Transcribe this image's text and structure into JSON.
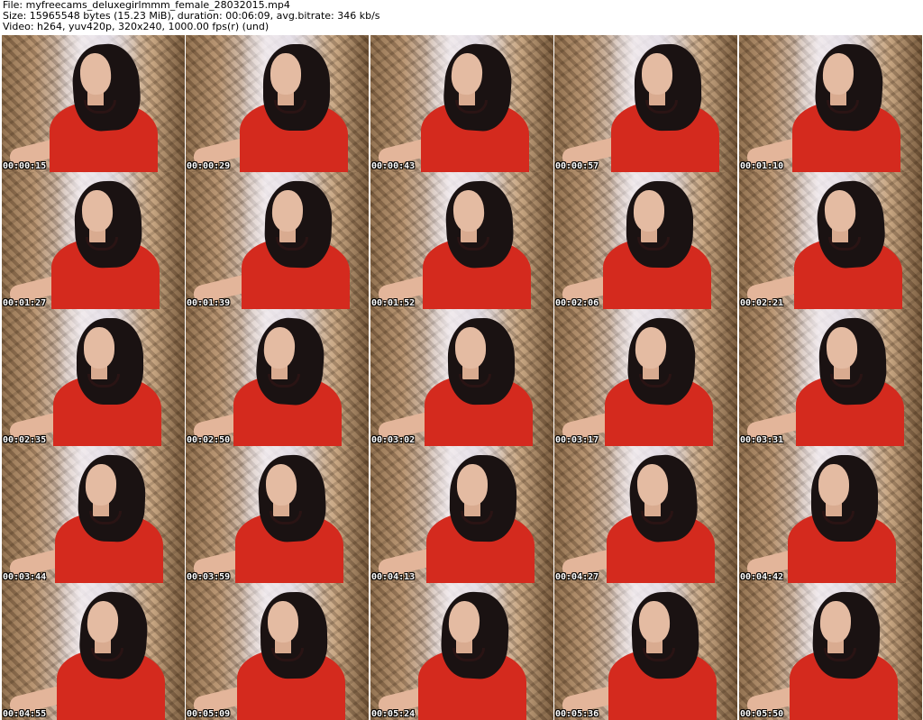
{
  "header": {
    "line1": "File: myfreecams_deluxegirlmmm_female_28032015.mp4",
    "line2": "Size: 15965548 bytes (15.23 MiB), duration: 00:06:09, avg.bitrate: 346 kb/s",
    "line3": "Video: h264, yuv420p, 320x240, 1000.00 fps(r) (und)"
  },
  "thumbnails": [
    {
      "timestamp": "00:00:15"
    },
    {
      "timestamp": "00:00:29"
    },
    {
      "timestamp": "00:00:43"
    },
    {
      "timestamp": "00:00:57"
    },
    {
      "timestamp": "00:01:10"
    },
    {
      "timestamp": "00:01:27"
    },
    {
      "timestamp": "00:01:39"
    },
    {
      "timestamp": "00:01:52"
    },
    {
      "timestamp": "00:02:06"
    },
    {
      "timestamp": "00:02:21"
    },
    {
      "timestamp": "00:02:35"
    },
    {
      "timestamp": "00:02:50"
    },
    {
      "timestamp": "00:03:02"
    },
    {
      "timestamp": "00:03:17"
    },
    {
      "timestamp": "00:03:31"
    },
    {
      "timestamp": "00:03:44"
    },
    {
      "timestamp": "00:03:59"
    },
    {
      "timestamp": "00:04:13"
    },
    {
      "timestamp": "00:04:27"
    },
    {
      "timestamp": "00:04:42"
    },
    {
      "timestamp": "00:04:55"
    },
    {
      "timestamp": "00:05:09"
    },
    {
      "timestamp": "00:05:24"
    },
    {
      "timestamp": "00:05:36"
    },
    {
      "timestamp": "00:05:50"
    }
  ]
}
